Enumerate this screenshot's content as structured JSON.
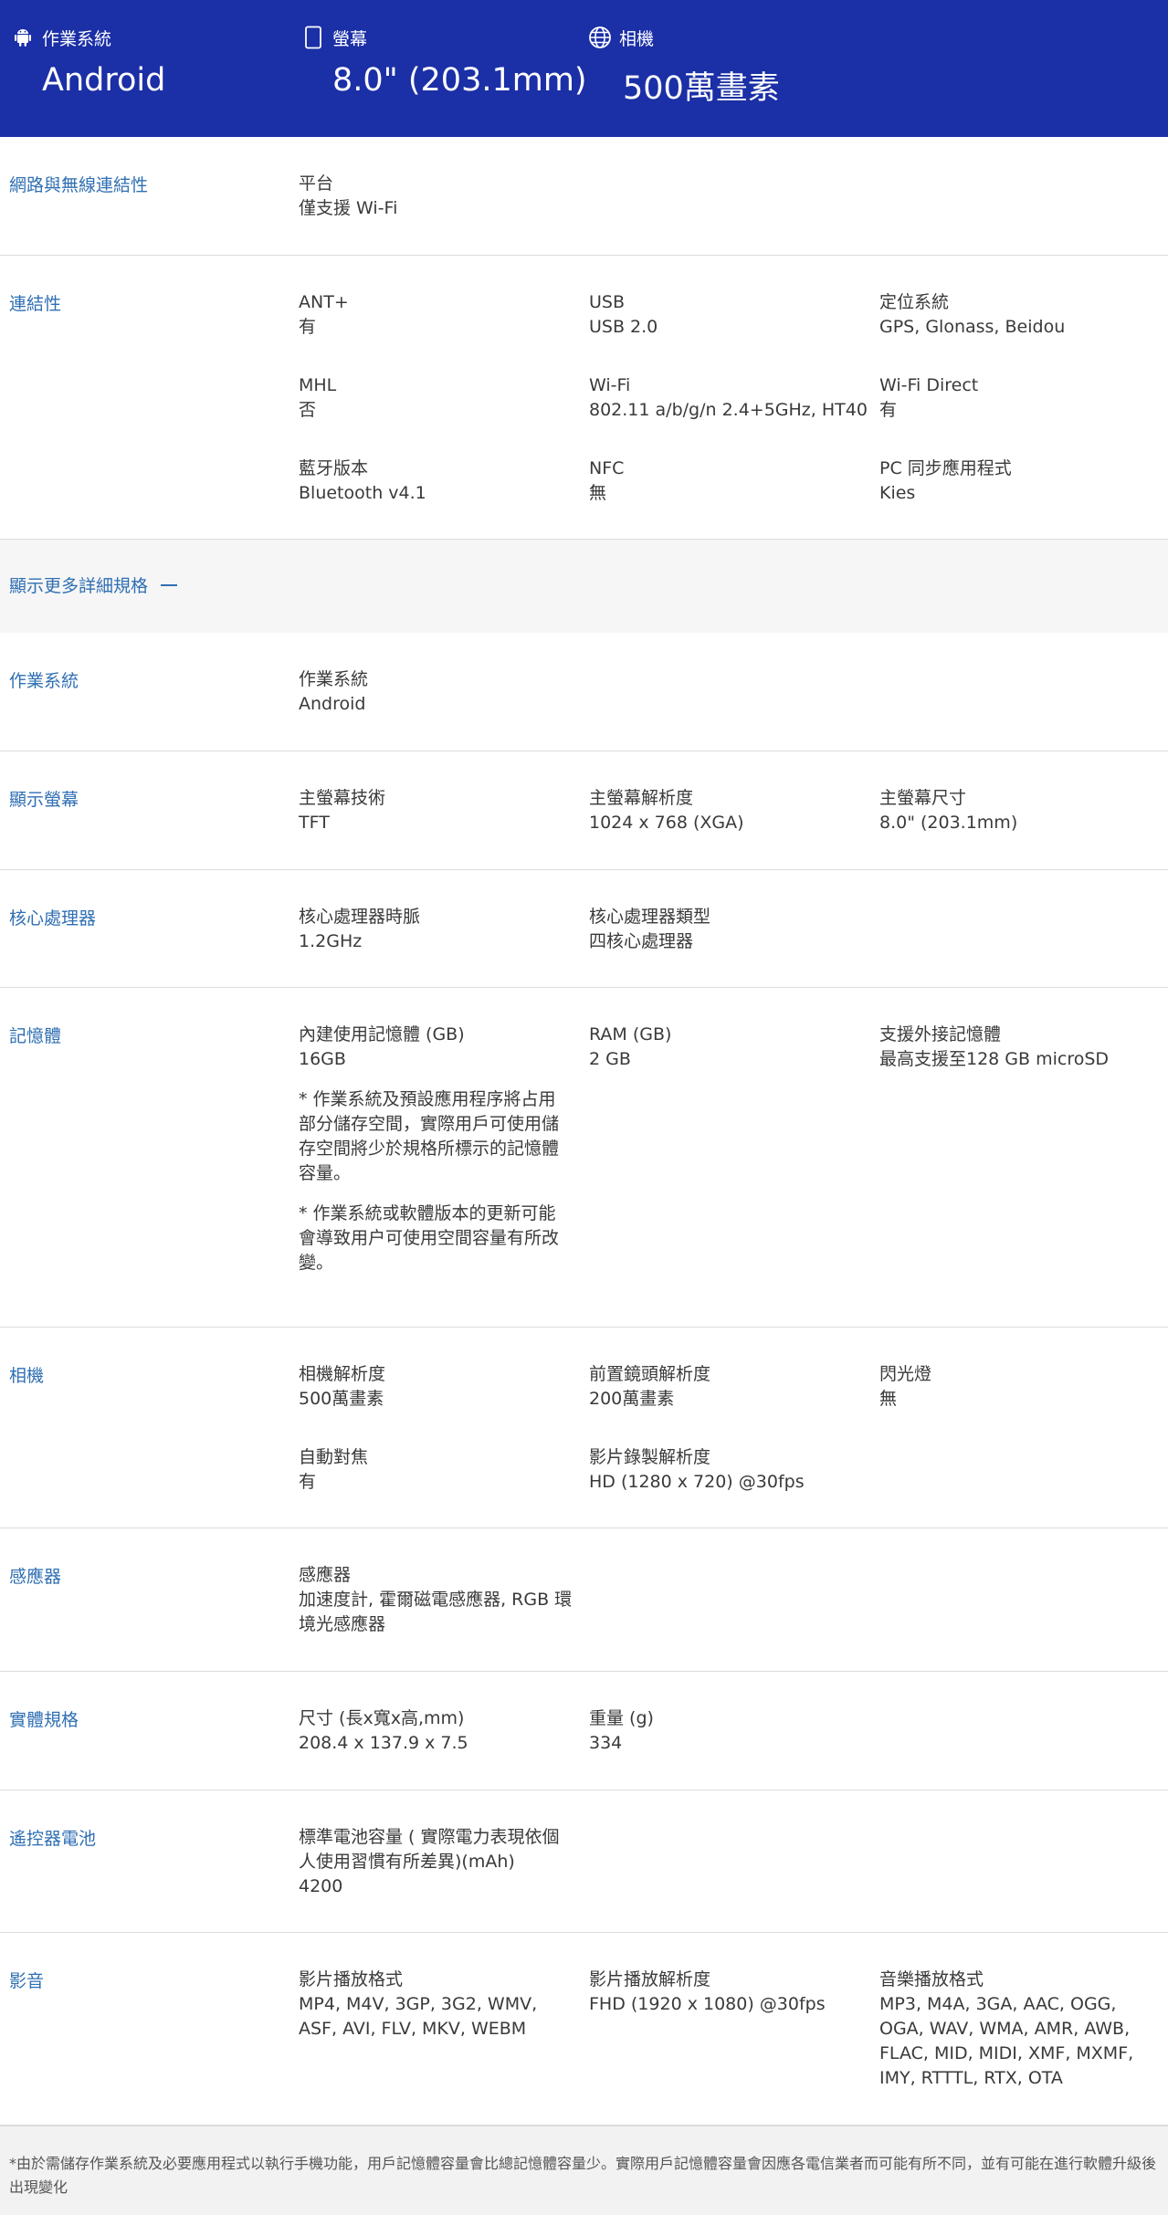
{
  "hero": {
    "os": {
      "label": "作業系統",
      "value": "Android",
      "icon": "android-icon"
    },
    "screen": {
      "label": "螢幕",
      "value": "8.0\" (203.1mm)",
      "icon": "tablet-icon"
    },
    "camera": {
      "label": "相機",
      "value": "500萬畫素",
      "icon": "globe-icon"
    }
  },
  "network": {
    "title": "網路與無線連結性",
    "platform": {
      "label": "平台",
      "value": "僅支援 Wi-Fi"
    }
  },
  "connectivity": {
    "title": "連結性",
    "ant": {
      "label": "ANT+",
      "value": "有"
    },
    "usb": {
      "label": "USB",
      "value": "USB 2.0"
    },
    "location": {
      "label": "定位系統",
      "value": "GPS, Glonass, Beidou"
    },
    "mhl": {
      "label": "MHL",
      "value": "否"
    },
    "wifi": {
      "label": "Wi-Fi",
      "value": "802.11 a/b/g/n 2.4+5GHz, HT40"
    },
    "wifi_direct": {
      "label": "Wi-Fi Direct",
      "value": "有"
    },
    "bluetooth": {
      "label": "藍牙版本",
      "value": "Bluetooth v4.1"
    },
    "nfc": {
      "label": "NFC",
      "value": "無"
    },
    "pc_sync": {
      "label": "PC 同步應用程式",
      "value": "Kies"
    }
  },
  "more": {
    "label": "顯示更多詳細規格"
  },
  "os_section": {
    "title": "作業系統",
    "os": {
      "label": "作業系統",
      "value": "Android"
    }
  },
  "display": {
    "title": "顯示螢幕",
    "tech": {
      "label": "主螢幕技術",
      "value": "TFT"
    },
    "resolution": {
      "label": "主螢幕解析度",
      "value": "1024 x 768 (XGA)"
    },
    "size": {
      "label": "主螢幕尺寸",
      "value": "8.0\" (203.1mm)"
    }
  },
  "processor": {
    "title": "核心處理器",
    "clock": {
      "label": "核心處理器時脈",
      "value": "1.2GHz"
    },
    "type": {
      "label": "核心處理器類型",
      "value": "四核心處理器"
    }
  },
  "memory": {
    "title": "記憶體",
    "internal": {
      "label": "內建使用記憶體 (GB)",
      "value": "16GB"
    },
    "note1": "* 作業系統及預設應用程序將占用部分儲存空間，實際用戶可使用儲存空間將少於規格所標示的記憶體容量。",
    "note2": "* 作業系統或軟體版本的更新可能會導致用户可使用空間容量有所改變。",
    "ram": {
      "label": "RAM (GB)",
      "value": "2 GB"
    },
    "external": {
      "label": "支援外接記憶體",
      "value": "最高支援至128 GB microSD"
    }
  },
  "camera": {
    "title": "相機",
    "rear": {
      "label": "相機解析度",
      "value": "500萬畫素"
    },
    "front": {
      "label": "前置鏡頭解析度",
      "value": "200萬畫素"
    },
    "flash": {
      "label": "閃光燈",
      "value": "無"
    },
    "autofocus": {
      "label": "自動對焦",
      "value": "有"
    },
    "video": {
      "label": "影片錄製解析度",
      "value": "HD (1280 x 720) @30fps"
    }
  },
  "sensors": {
    "title": "感應器",
    "sensor": {
      "label": "感應器",
      "value": "加速度計, 霍爾磁電感應器, RGB 環境光感應器"
    }
  },
  "physical": {
    "title": "實體規格",
    "dimensions": {
      "label": "尺寸 (長x寬x高,mm)",
      "value": "208.4 x 137.9 x 7.5"
    },
    "weight": {
      "label": "重量 (g)",
      "value": "334"
    }
  },
  "battery": {
    "title": "遙控器電池",
    "capacity": {
      "label": "標準電池容量 ( 實際電力表現依個人使用習慣有所差異)(mAh)",
      "value": "4200"
    }
  },
  "av": {
    "title": "影音",
    "video_format": {
      "label": "影片播放格式",
      "value": "MP4, M4V, 3GP, 3G2, WMV, ASF, AVI, FLV, MKV, WEBM"
    },
    "video_res": {
      "label": "影片播放解析度",
      "value": "FHD (1920 x 1080) @30fps"
    },
    "audio_format": {
      "label": "音樂播放格式",
      "value": "MP3, M4A, 3GA, AAC, OGG, OGA, WAV, WMA, AMR, AWB, FLAC, MID, MIDI, XMF, MXMF, IMY, RTTTL, RTX, OTA"
    }
  },
  "footer": {
    "text": "*由於需儲存作業系統及必要應用程式以執行手機功能，用戶記憶體容量會比總記憶體容量少。實際用戶記憶體容量會因應各電信業者而可能有所不同，並有可能在進行軟體升級後出現變化"
  }
}
